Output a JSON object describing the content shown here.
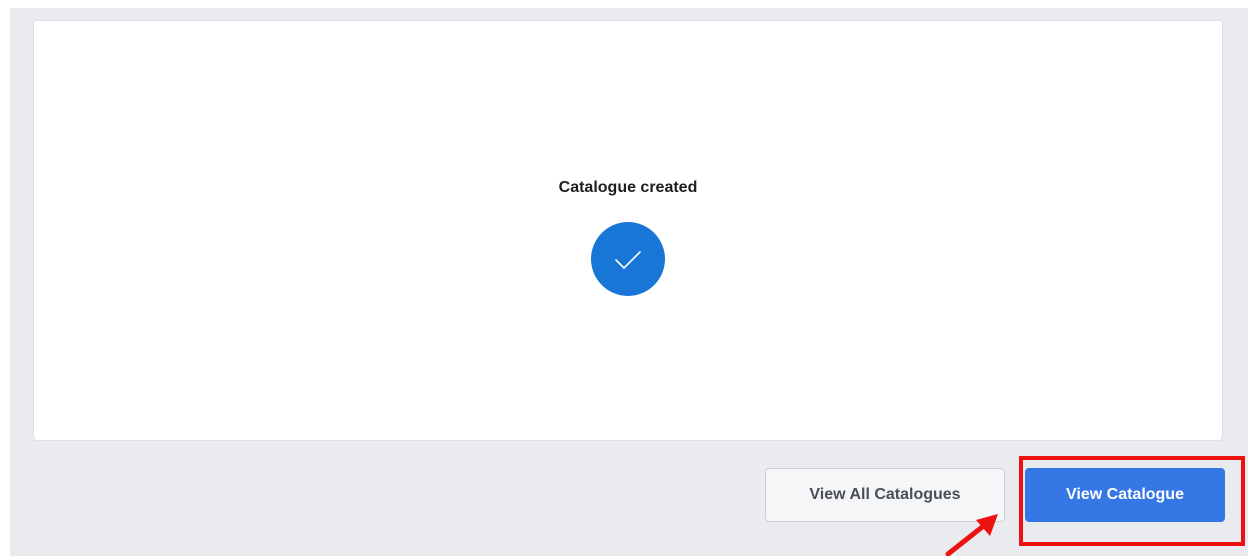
{
  "card": {
    "title": "Catalogue created"
  },
  "icons": {
    "success": "check-circle-icon"
  },
  "actions": {
    "view_all_label": "View All Catalogues",
    "view_label": "View Catalogue"
  },
  "colors": {
    "accent": "#3578e5",
    "success_circle": "#1877d6",
    "highlight": "#ee1111",
    "background": "#e9ebee"
  }
}
